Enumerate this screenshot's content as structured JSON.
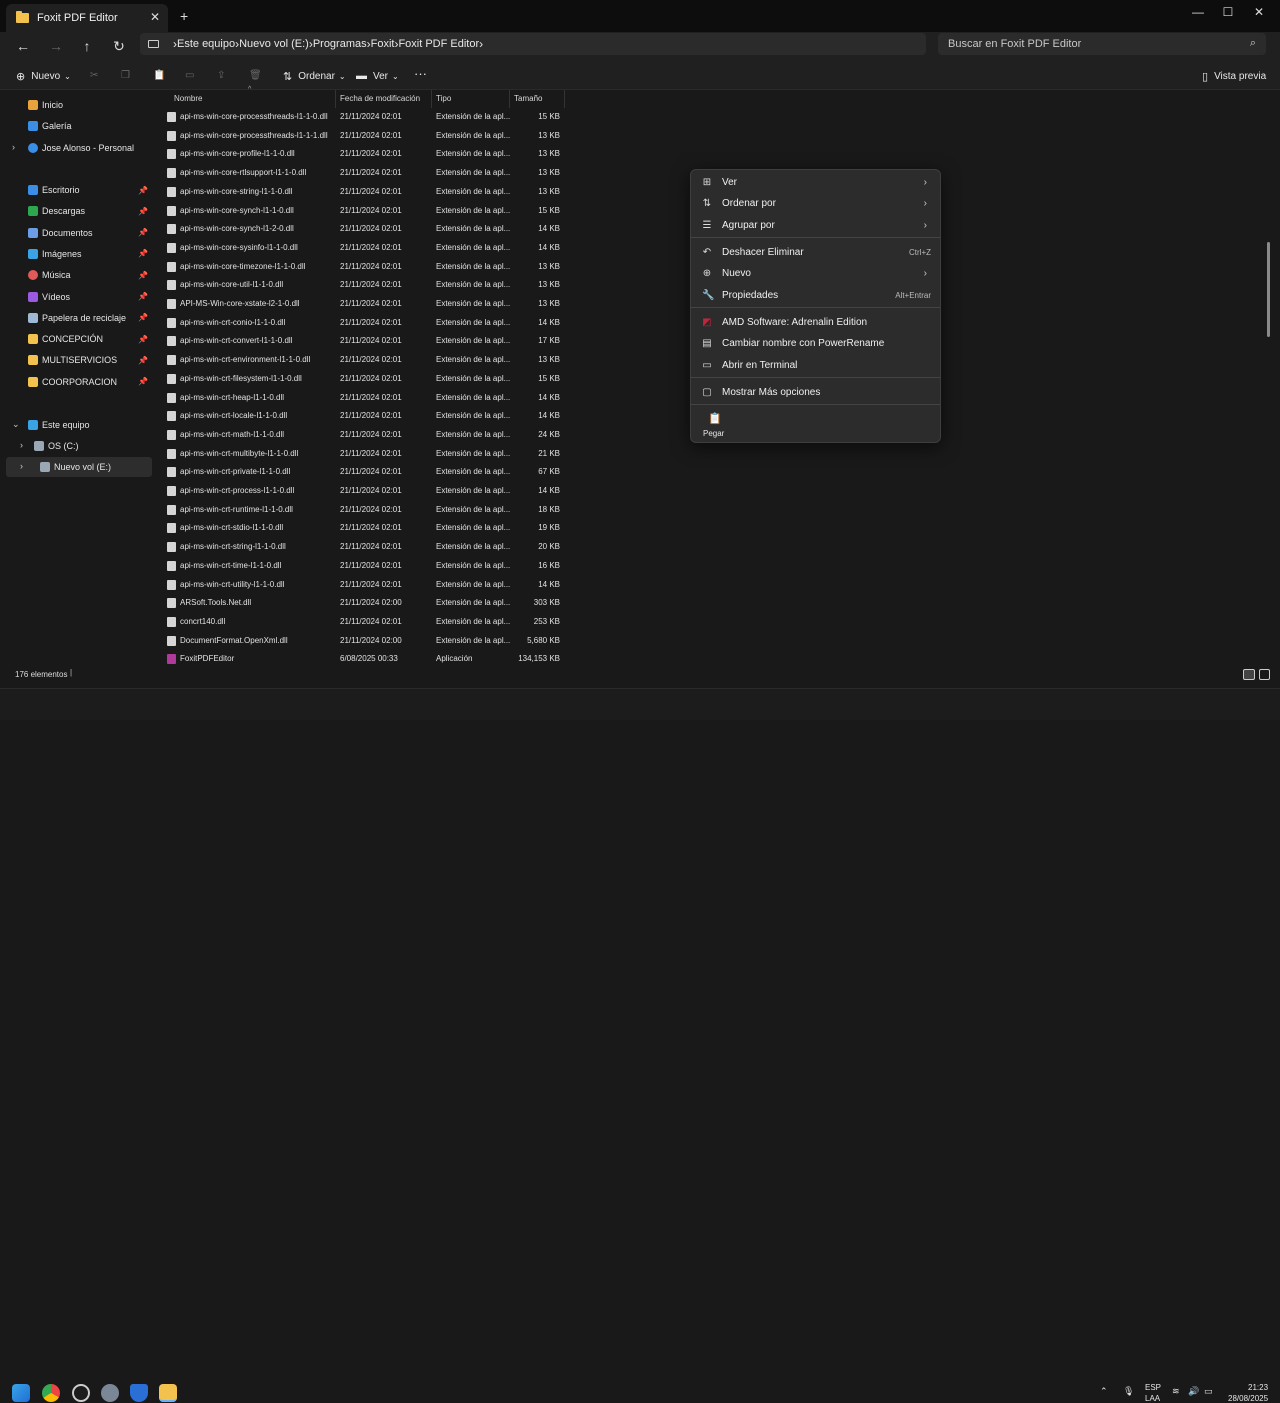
{
  "window": {
    "tab_title": "Foxit PDF Editor",
    "tab_close": "✕",
    "new_tab": "+",
    "minimize": "—",
    "maximize": "☐",
    "close": "✕"
  },
  "nav": {
    "back": "←",
    "forward": "→",
    "up": "↑",
    "refresh": "↻"
  },
  "breadcrumbs": [
    "Este equipo",
    "Nuevo vol (E:)",
    "Programas",
    "Foxit",
    "Foxit PDF Editor"
  ],
  "search": {
    "placeholder": "Buscar en Foxit PDF Editor"
  },
  "toolbar": {
    "new_label": "Nuevo",
    "sort_label": "Ordenar",
    "view_label": "Ver",
    "more": "···",
    "preview_label": "Vista previa"
  },
  "sidebar": {
    "quick": [
      {
        "label": "Inicio",
        "color": "#e8a33d"
      },
      {
        "label": "Galería",
        "color": "#3a8ee6"
      },
      {
        "label": "Jose Alonso - Personal",
        "color": "#3a8ee6"
      }
    ],
    "pinned": [
      {
        "label": "Escritorio",
        "color": "#3a8ee6"
      },
      {
        "label": "Descargas",
        "color": "#2ea84f"
      },
      {
        "label": "Documentos",
        "color": "#6b9ee6"
      },
      {
        "label": "Imágenes",
        "color": "#3aa3e6"
      },
      {
        "label": "Música",
        "color": "#e05a5a"
      },
      {
        "label": "Vídeos",
        "color": "#9b5ae0"
      },
      {
        "label": "Papelera de reciclaje",
        "color": "#9fb8d4"
      },
      {
        "label": "CONCEPCIÓN",
        "color": "#f2c14e"
      },
      {
        "label": "MULTISERVICIOS",
        "color": "#f2c14e"
      },
      {
        "label": "COORPORACION",
        "color": "#f2c14e"
      }
    ],
    "pc": {
      "label": "Este equipo",
      "color": "#3aa3e6"
    },
    "drives": [
      {
        "label": "OS (C:)",
        "color": "#9aa7b5"
      },
      {
        "label": "Nuevo vol (E:)",
        "color": "#9aa7b5"
      }
    ]
  },
  "columns": [
    "Nombre",
    "Fecha de modificación",
    "Tipo",
    "Tamaño"
  ],
  "files": [
    {
      "name": "api-ms-win-core-processthreads-l1-1-0.dll",
      "date": "21/11/2024 02:01",
      "type": "Extensión de la apl...",
      "size": "15 KB"
    },
    {
      "name": "api-ms-win-core-processthreads-l1-1-1.dll",
      "date": "21/11/2024 02:01",
      "type": "Extensión de la apl...",
      "size": "13 KB"
    },
    {
      "name": "api-ms-win-core-profile-l1-1-0.dll",
      "date": "21/11/2024 02:01",
      "type": "Extensión de la apl...",
      "size": "13 KB"
    },
    {
      "name": "api-ms-win-core-rtlsupport-l1-1-0.dll",
      "date": "21/11/2024 02:01",
      "type": "Extensión de la apl...",
      "size": "13 KB"
    },
    {
      "name": "api-ms-win-core-string-l1-1-0.dll",
      "date": "21/11/2024 02:01",
      "type": "Extensión de la apl...",
      "size": "13 KB"
    },
    {
      "name": "api-ms-win-core-synch-l1-1-0.dll",
      "date": "21/11/2024 02:01",
      "type": "Extensión de la apl...",
      "size": "15 KB"
    },
    {
      "name": "api-ms-win-core-synch-l1-2-0.dll",
      "date": "21/11/2024 02:01",
      "type": "Extensión de la apl...",
      "size": "14 KB"
    },
    {
      "name": "api-ms-win-core-sysinfo-l1-1-0.dll",
      "date": "21/11/2024 02:01",
      "type": "Extensión de la apl...",
      "size": "14 KB"
    },
    {
      "name": "api-ms-win-core-timezone-l1-1-0.dll",
      "date": "21/11/2024 02:01",
      "type": "Extensión de la apl...",
      "size": "13 KB"
    },
    {
      "name": "api-ms-win-core-util-l1-1-0.dll",
      "date": "21/11/2024 02:01",
      "type": "Extensión de la apl...",
      "size": "13 KB"
    },
    {
      "name": "API-MS-Win-core-xstate-l2-1-0.dll",
      "date": "21/11/2024 02:01",
      "type": "Extensión de la apl...",
      "size": "13 KB"
    },
    {
      "name": "api-ms-win-crt-conio-l1-1-0.dll",
      "date": "21/11/2024 02:01",
      "type": "Extensión de la apl...",
      "size": "14 KB"
    },
    {
      "name": "api-ms-win-crt-convert-l1-1-0.dll",
      "date": "21/11/2024 02:01",
      "type": "Extensión de la apl...",
      "size": "17 KB"
    },
    {
      "name": "api-ms-win-crt-environment-l1-1-0.dll",
      "date": "21/11/2024 02:01",
      "type": "Extensión de la apl...",
      "size": "13 KB"
    },
    {
      "name": "api-ms-win-crt-filesystem-l1-1-0.dll",
      "date": "21/11/2024 02:01",
      "type": "Extensión de la apl...",
      "size": "15 KB"
    },
    {
      "name": "api-ms-win-crt-heap-l1-1-0.dll",
      "date": "21/11/2024 02:01",
      "type": "Extensión de la apl...",
      "size": "14 KB"
    },
    {
      "name": "api-ms-win-crt-locale-l1-1-0.dll",
      "date": "21/11/2024 02:01",
      "type": "Extensión de la apl...",
      "size": "14 KB"
    },
    {
      "name": "api-ms-win-crt-math-l1-1-0.dll",
      "date": "21/11/2024 02:01",
      "type": "Extensión de la apl...",
      "size": "24 KB"
    },
    {
      "name": "api-ms-win-crt-multibyte-l1-1-0.dll",
      "date": "21/11/2024 02:01",
      "type": "Extensión de la apl...",
      "size": "21 KB"
    },
    {
      "name": "api-ms-win-crt-private-l1-1-0.dll",
      "date": "21/11/2024 02:01",
      "type": "Extensión de la apl...",
      "size": "67 KB"
    },
    {
      "name": "api-ms-win-crt-process-l1-1-0.dll",
      "date": "21/11/2024 02:01",
      "type": "Extensión de la apl...",
      "size": "14 KB"
    },
    {
      "name": "api-ms-win-crt-runtime-l1-1-0.dll",
      "date": "21/11/2024 02:01",
      "type": "Extensión de la apl...",
      "size": "18 KB"
    },
    {
      "name": "api-ms-win-crt-stdio-l1-1-0.dll",
      "date": "21/11/2024 02:01",
      "type": "Extensión de la apl...",
      "size": "19 KB"
    },
    {
      "name": "api-ms-win-crt-string-l1-1-0.dll",
      "date": "21/11/2024 02:01",
      "type": "Extensión de la apl...",
      "size": "20 KB"
    },
    {
      "name": "api-ms-win-crt-time-l1-1-0.dll",
      "date": "21/11/2024 02:01",
      "type": "Extensión de la apl...",
      "size": "16 KB"
    },
    {
      "name": "api-ms-win-crt-utility-l1-1-0.dll",
      "date": "21/11/2024 02:01",
      "type": "Extensión de la apl...",
      "size": "14 KB"
    },
    {
      "name": "ARSoft.Tools.Net.dll",
      "date": "21/11/2024 02:00",
      "type": "Extensión de la apl...",
      "size": "303 KB"
    },
    {
      "name": "concrt140.dll",
      "date": "21/11/2024 02:01",
      "type": "Extensión de la apl...",
      "size": "253 KB"
    },
    {
      "name": "DocumentFormat.OpenXml.dll",
      "date": "21/11/2024 02:00",
      "type": "Extensión de la apl...",
      "size": "5,680 KB"
    },
    {
      "name": "FoxitPDFEditor",
      "date": "6/08/2025 00:33",
      "type": "Aplicación",
      "size": "134,153 KB"
    }
  ],
  "status": {
    "count": "176 elementos"
  },
  "context_menu": {
    "items": [
      {
        "label": "Ver",
        "icon": "view-icon",
        "glyph": "⊞",
        "shortcut": "",
        "submenu": true
      },
      {
        "label": "Ordenar por",
        "icon": "sort-icon",
        "glyph": "⇅",
        "shortcut": "",
        "submenu": true
      },
      {
        "label": "Agrupar por",
        "icon": "group-icon",
        "glyph": "☰",
        "shortcut": "",
        "submenu": true
      },
      {
        "label": "Deshacer Eliminar",
        "icon": "undo-icon",
        "glyph": "↶",
        "shortcut": "Ctrl+Z",
        "submenu": false
      },
      {
        "label": "Nuevo",
        "icon": "new-icon",
        "glyph": "⊕",
        "shortcut": "",
        "submenu": true
      },
      {
        "label": "Propiedades",
        "icon": "properties-icon",
        "glyph": "🔧",
        "shortcut": "Alt+Entrar",
        "submenu": false
      },
      {
        "label": "AMD Software: Adrenalin Edition",
        "icon": "amd-icon",
        "glyph": "◩",
        "shortcut": "",
        "submenu": false
      },
      {
        "label": "Cambiar nombre con PowerRename",
        "icon": "powerrename-icon",
        "glyph": "▤",
        "shortcut": "",
        "submenu": false
      },
      {
        "label": "Abrir en Terminal",
        "icon": "terminal-icon",
        "glyph": "▭",
        "shortcut": "",
        "submenu": false
      },
      {
        "label": "Mostrar Más opciones",
        "icon": "more-options-icon",
        "glyph": "▢",
        "shortcut": "",
        "submenu": false
      }
    ],
    "arrow": "›",
    "paste_label": "Pegar"
  },
  "taskbar": {
    "lang1": "ESP",
    "lang2": "LAA",
    "time": "21:23",
    "date": "28/08/2025",
    "chevron": "⌃"
  },
  "colors": {
    "accent": "#3aa3e6",
    "folder": "#f2c14e",
    "amd": "#c0273d"
  }
}
